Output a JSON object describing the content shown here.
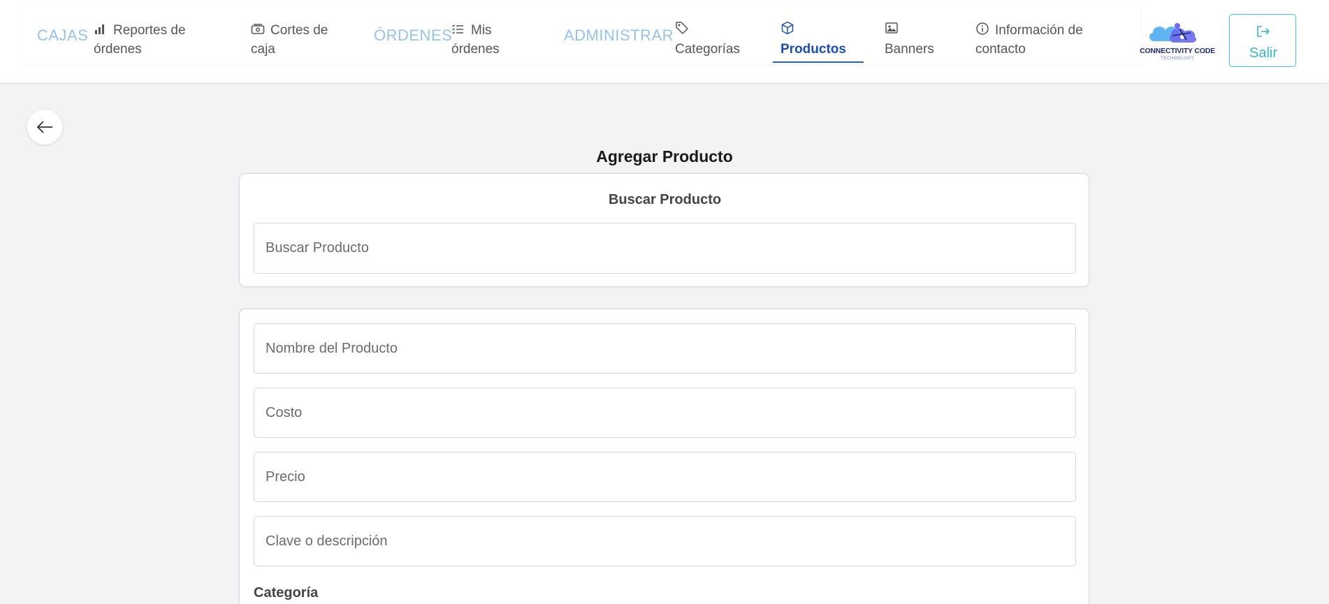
{
  "nav": {
    "sections": {
      "cajas": "CAJAS",
      "ordenes": "ÓRDENES",
      "administrar": "ADMINISTRAR"
    },
    "items": {
      "reportes": "Reportes de órdenes",
      "cortes": "Cortes de caja",
      "mis_ordenes": "Mis órdenes",
      "categorias": "Categorías",
      "productos": "Productos",
      "banners": "Banners",
      "informacion": "Información de contacto"
    },
    "active_item": "Productos",
    "logo_text": "CONNECTIVITY CODE",
    "logo_sub": "TECHNOLOGY",
    "exit_label": "Salir"
  },
  "page": {
    "title": "Agregar Producto"
  },
  "search_card": {
    "title": "Buscar Producto",
    "placeholder": "Buscar Producto"
  },
  "form": {
    "name_placeholder": "Nombre del Producto",
    "cost_placeholder": "Costo",
    "price_placeholder": "Precio",
    "key_placeholder": "Clave o descripción",
    "category_label": "Categoría"
  },
  "colors": {
    "section_label": "#93c2ef",
    "active_nav": "#1b4fae",
    "exit_button": "#35b8cf"
  }
}
